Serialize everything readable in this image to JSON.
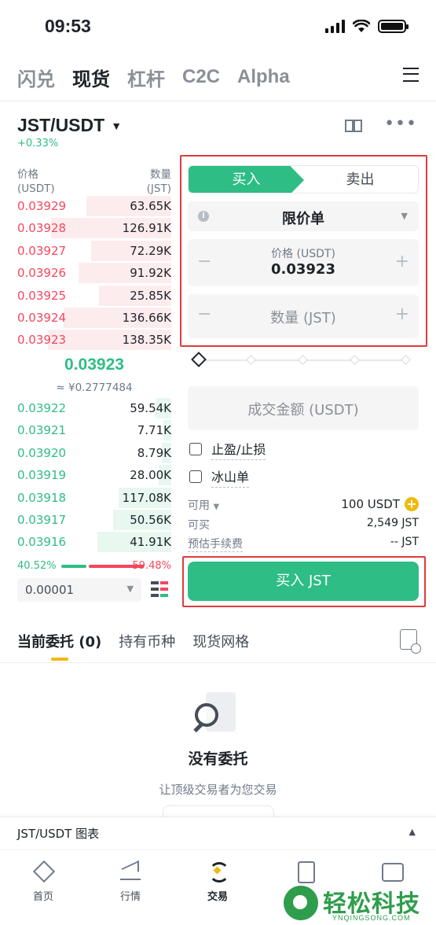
{
  "status": {
    "time": "09:53"
  },
  "top_tabs": [
    "闪兑",
    "现货",
    "杠杆",
    "C2C",
    "Alpha"
  ],
  "pair": {
    "name": "JST/USDT",
    "change": "+0.33%"
  },
  "orderbook": {
    "price_label": "价格",
    "price_unit": "(USDT)",
    "qty_label": "数量",
    "qty_unit": "(JST)",
    "asks": [
      {
        "price": "0.03929",
        "qty": "63.65K",
        "depth": 0.55
      },
      {
        "price": "0.03928",
        "qty": "126.91K",
        "depth": 0.78
      },
      {
        "price": "0.03927",
        "qty": "72.29K",
        "depth": 0.52
      },
      {
        "price": "0.03926",
        "qty": "91.92K",
        "depth": 0.6
      },
      {
        "price": "0.03925",
        "qty": "25.85K",
        "depth": 0.47
      },
      {
        "price": "0.03924",
        "qty": "136.66K",
        "depth": 0.7
      },
      {
        "price": "0.03923",
        "qty": "138.35K",
        "depth": 0.8
      }
    ],
    "mid_price": "0.03923",
    "mid_fiat": "≈ ¥0.2777484",
    "bids": [
      {
        "price": "0.03922",
        "qty": "59.54K",
        "depth": 0.1
      },
      {
        "price": "0.03921",
        "qty": "7.71K",
        "depth": 0.05
      },
      {
        "price": "0.03920",
        "qty": "8.79K",
        "depth": 0.06
      },
      {
        "price": "0.03919",
        "qty": "28.00K",
        "depth": 0.08
      },
      {
        "price": "0.03918",
        "qty": "117.08K",
        "depth": 0.34
      },
      {
        "price": "0.03917",
        "qty": "50.56K",
        "depth": 0.38
      },
      {
        "price": "0.03916",
        "qty": "41.91K",
        "depth": 0.48
      }
    ],
    "buy_ratio": "40.52%",
    "sell_ratio": "59.48%",
    "step": "0.00001"
  },
  "form": {
    "buy_tab": "买入",
    "sell_tab": "卖出",
    "order_type": "限价单",
    "price_label": "价格 (USDT)",
    "price_value": "0.03923",
    "qty_placeholder": "数量 (JST)",
    "total_placeholder": "成交金额 (USDT)",
    "tp_sl": "止盈/止损",
    "iceberg": "冰山单",
    "available_label": "可用",
    "available_value": "100 USDT",
    "can_buy_label": "可买",
    "can_buy_value": "2,549 JST",
    "fee_label": "预估手续费",
    "fee_value": "-- JST",
    "submit": "买入 JST"
  },
  "lower_tabs": [
    "当前委托 (0)",
    "持有币种",
    "现货网格"
  ],
  "empty": {
    "title": "没有委托",
    "subtitle": "让顶级交易者为您交易"
  },
  "chart_bar": {
    "label": "JST/USDT 图表"
  },
  "bottom_nav": [
    "首页",
    "行情",
    "交易",
    "",
    ""
  ],
  "watermark": {
    "name": "轻松科技",
    "url": "YNQINGSONG.COM"
  },
  "colors": {
    "green": "#2ebd85",
    "red": "#f6465d",
    "yellow": "#f0b90b",
    "highlight": "#e23b3b"
  }
}
